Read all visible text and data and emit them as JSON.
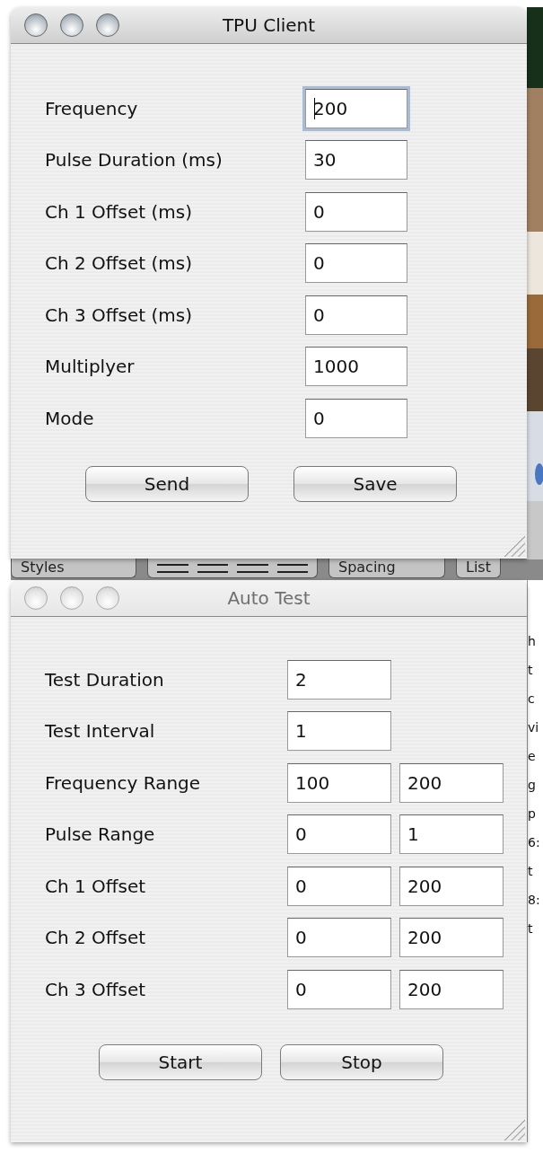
{
  "windows": [
    {
      "title": "TPU Client",
      "active": true,
      "fields": [
        {
          "label": "Frequency",
          "value": "200",
          "focused": true
        },
        {
          "label": "Pulse Duration (ms)",
          "value": "30",
          "focused": false
        },
        {
          "label": "Ch 1 Offset (ms)",
          "value": "0",
          "focused": false
        },
        {
          "label": "Ch 2 Offset (ms)",
          "value": "0",
          "focused": false
        },
        {
          "label": "Ch 3 Offset (ms)",
          "value": "0",
          "focused": false
        },
        {
          "label": "Multiplyer",
          "value": "1000",
          "focused": false
        },
        {
          "label": "Mode",
          "value": "0",
          "focused": false
        }
      ],
      "buttons": [
        "Send",
        "Save"
      ]
    },
    {
      "title": "Auto Test",
      "active": false,
      "fields": [
        {
          "label": "Test Duration",
          "values": [
            "2"
          ]
        },
        {
          "label": "Test Interval",
          "values": [
            "1"
          ]
        },
        {
          "label": "Frequency Range",
          "values": [
            "100",
            "200"
          ]
        },
        {
          "label": "Pulse Range",
          "values": [
            "0",
            "1"
          ]
        },
        {
          "label": "Ch 1 Offset",
          "values": [
            "0",
            "200"
          ]
        },
        {
          "label": "Ch 2 Offset",
          "values": [
            "0",
            "200"
          ]
        },
        {
          "label": "Ch 3 Offset",
          "values": [
            "0",
            "200"
          ]
        }
      ],
      "buttons": [
        "Start",
        "Stop"
      ]
    }
  ],
  "background_toolbar": {
    "items": [
      "Styles",
      "Spacing",
      "List"
    ]
  },
  "background_text": [
    "h",
    "t",
    "c",
    "vi",
    "e",
    "g",
    "p",
    "6:",
    "t",
    "8:",
    "t"
  ]
}
